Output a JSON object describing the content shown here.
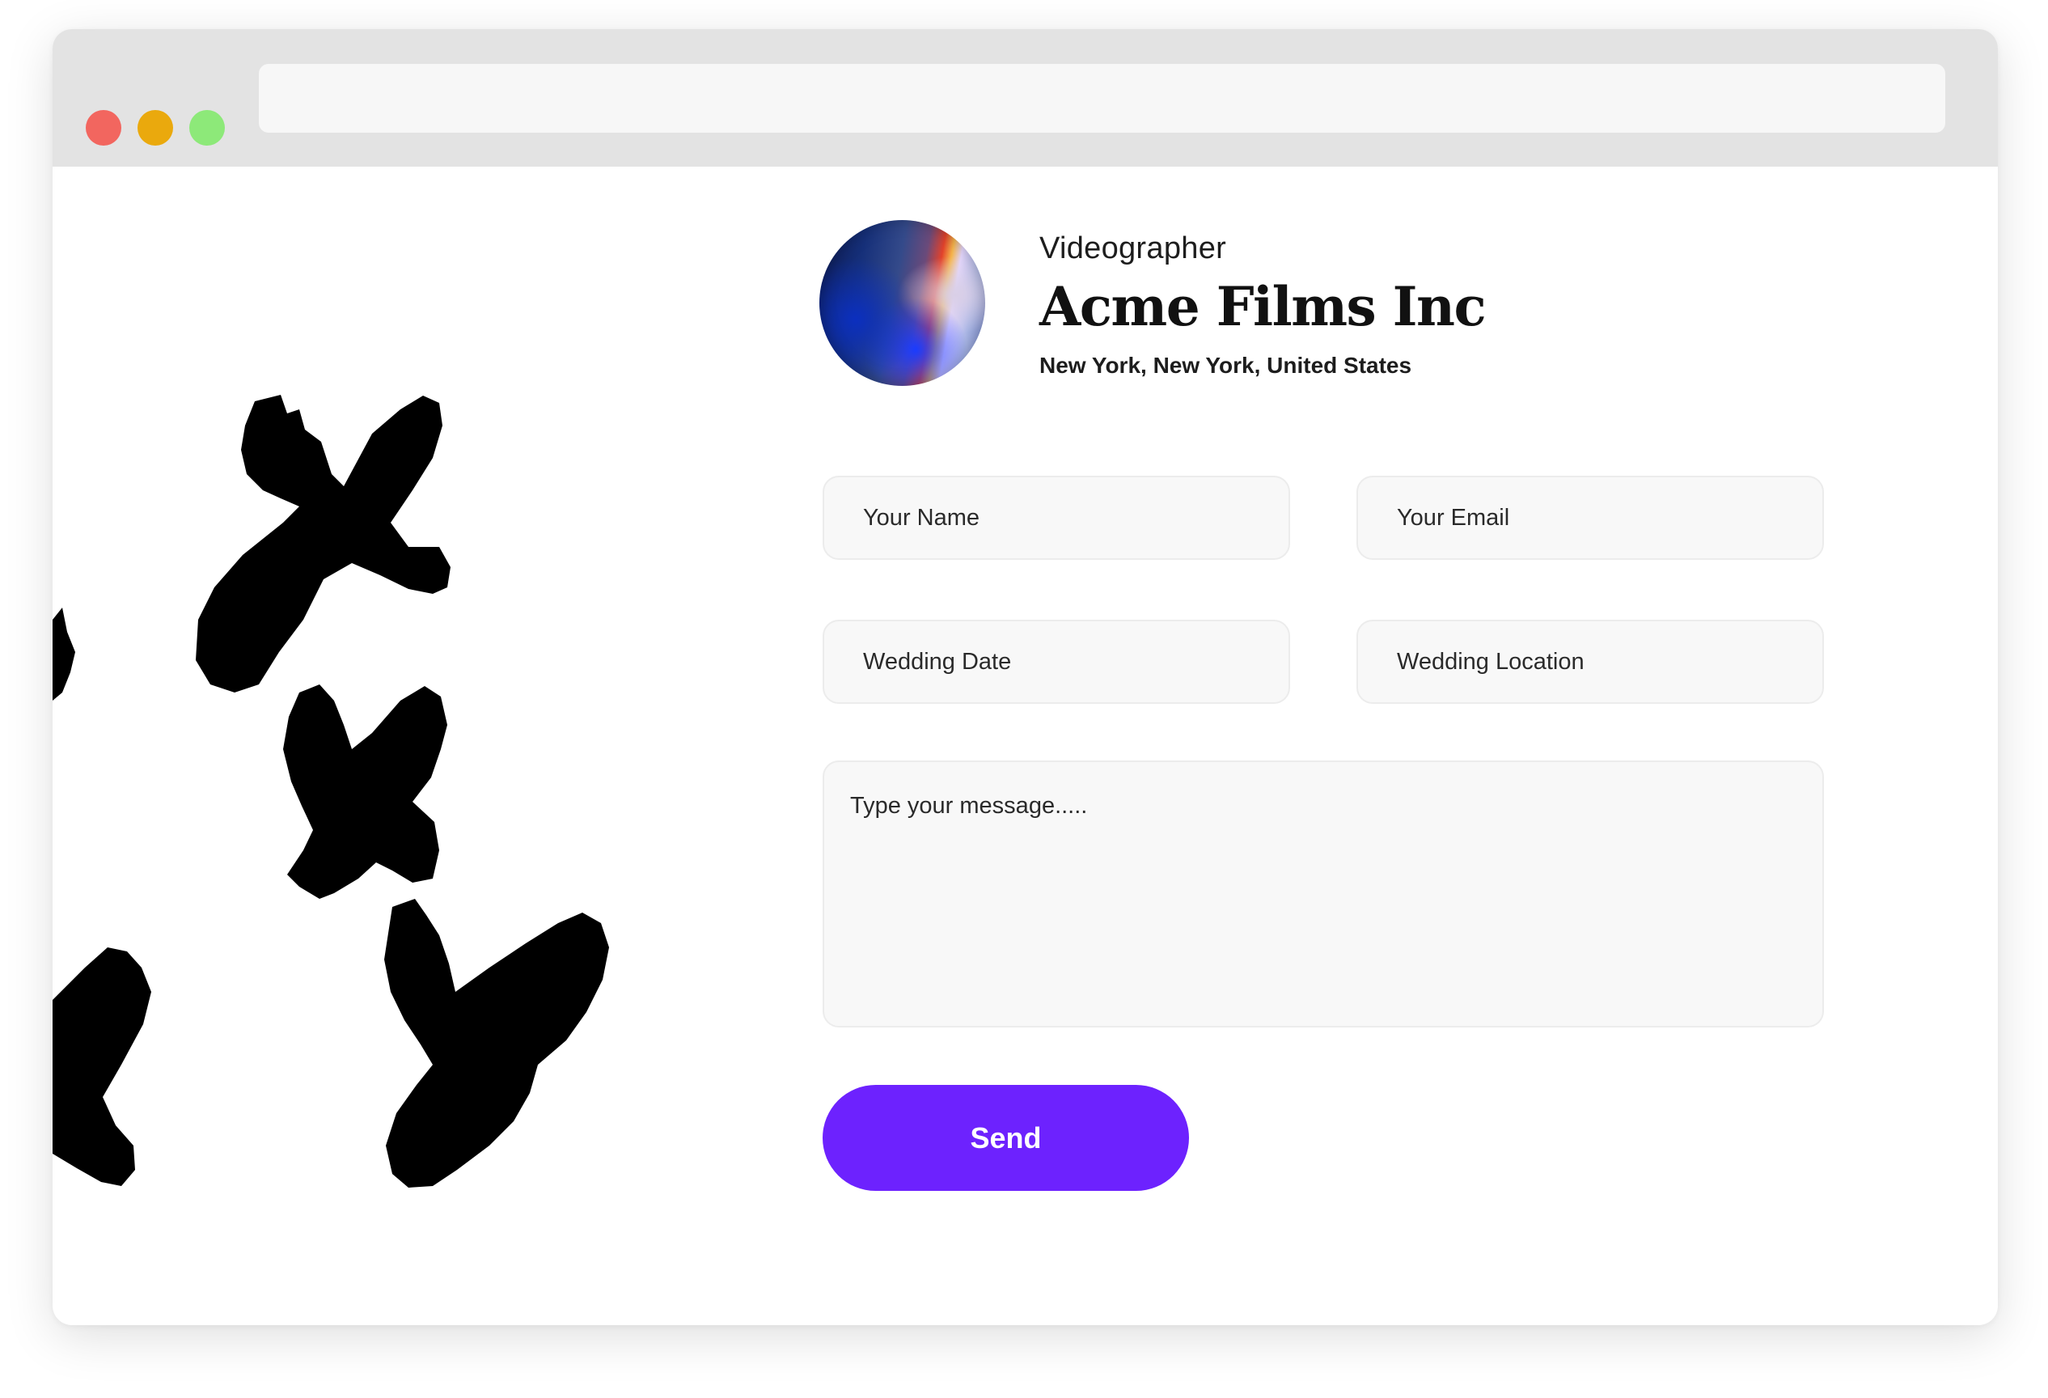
{
  "browser": {
    "traffic_lights": [
      {
        "name": "close",
        "color": "#f2665f"
      },
      {
        "name": "minimize",
        "color": "#eaa90d"
      },
      {
        "name": "maximize",
        "color": "#8de979"
      }
    ],
    "url": ""
  },
  "profile": {
    "role": "Videographer",
    "company": "Acme Films Inc",
    "location": "New York, New York, United States"
  },
  "form": {
    "name_placeholder": "Your Name",
    "email_placeholder": "Your Email",
    "date_placeholder": "Wedding Date",
    "location_placeholder": "Wedding Location",
    "message_placeholder": "Type your message.....",
    "send_label": "Send"
  },
  "colors": {
    "accent": "#6d22fe",
    "field_bg": "#f8f8f8",
    "titlebar": "#e3e3e3"
  }
}
